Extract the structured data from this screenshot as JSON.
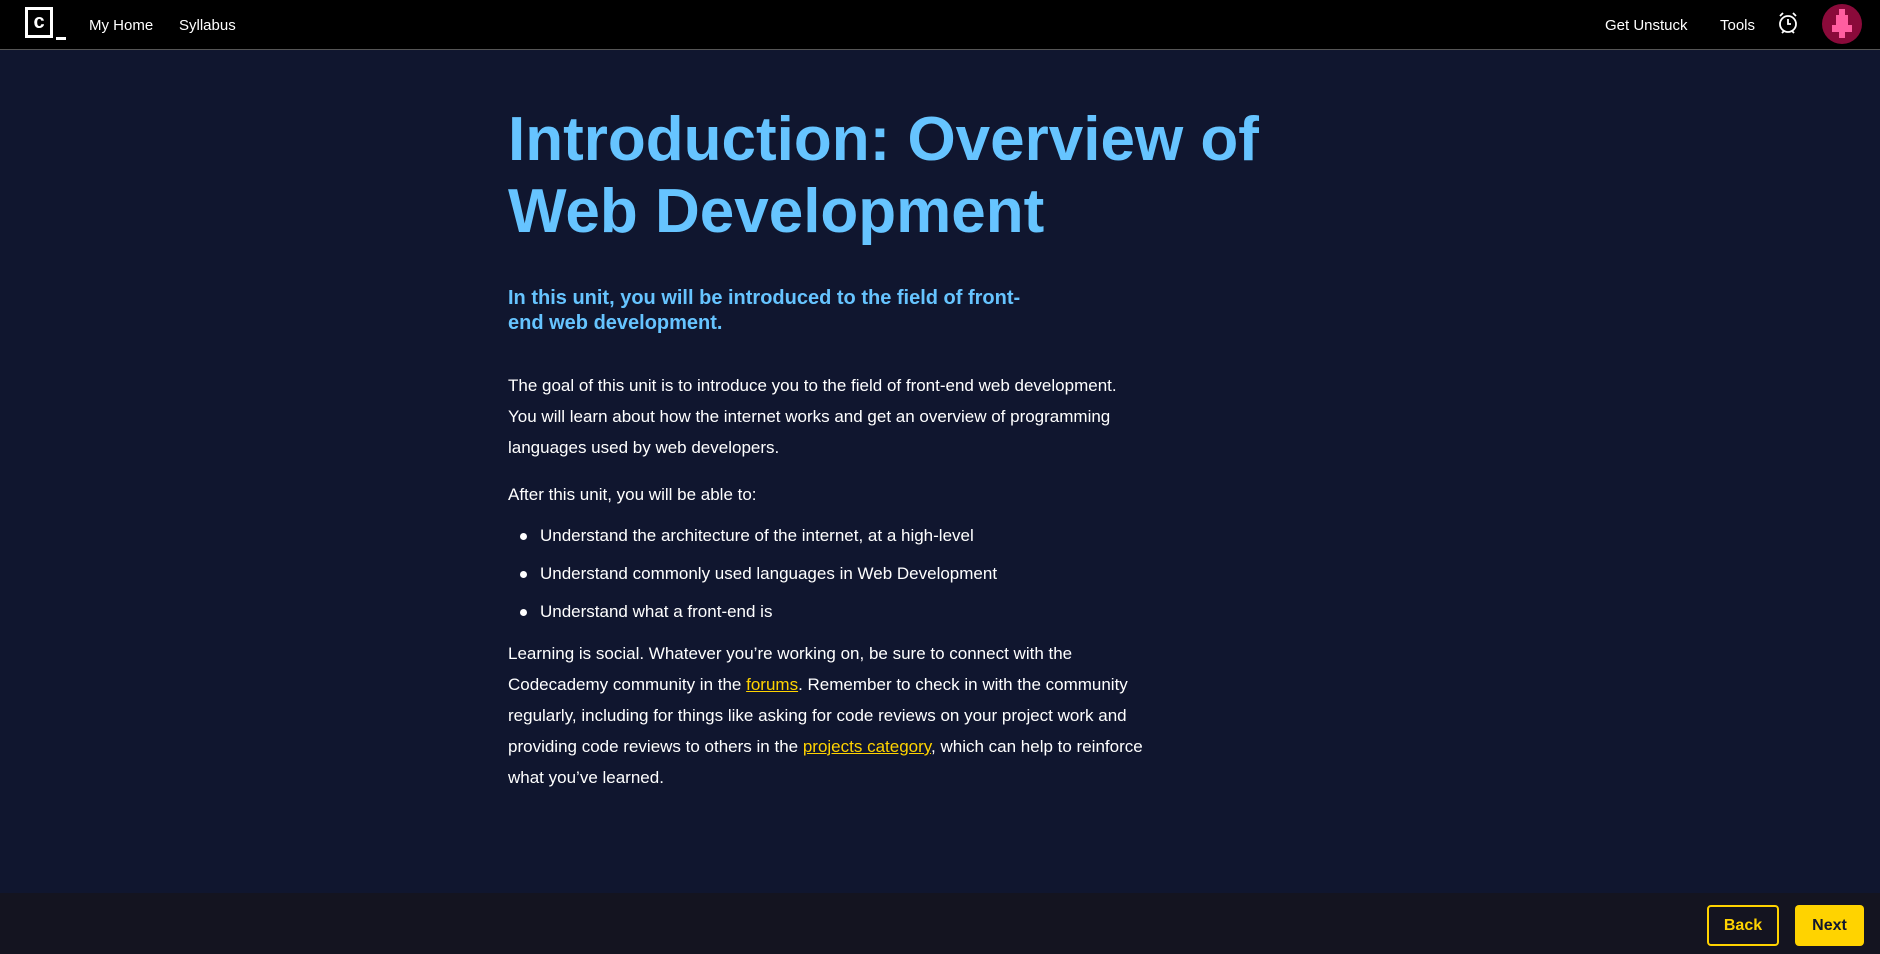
{
  "header": {
    "logo_letter": "c",
    "nav": [
      "My Home",
      "Syllabus"
    ],
    "right": [
      "Get Unstuck",
      "Tools"
    ],
    "icons": [
      "alarm-clock-icon",
      "avatar"
    ]
  },
  "main": {
    "title": "Introduction: Overview of Web Development",
    "subtitle": "In this unit, you will be introduced to the field of front-end web development.",
    "goal": "The goal of this unit is to introduce you to the field of front-end web development. You will learn about how the internet works and get an overview of programming languages used by web developers.",
    "after": "After this unit, you will be able to:",
    "bullets": [
      "Understand the architecture of the internet, at a high-level",
      "Understand commonly used languages in Web Development",
      "Understand what a front-end is"
    ],
    "social": {
      "t1": "Learning is social. Whatever you’re working on, be sure to connect with the Codecademy community in the ",
      "link1": "forums",
      "t2": ". Remember to check in with the community regularly, including for things like asking for code reviews on your project work and providing code reviews to others in the ",
      "link2": "projects category",
      "t3": ", which can help to reinforce what you’ve learned."
    }
  },
  "footer": {
    "back": "Back",
    "next": "Next"
  },
  "colors": {
    "accent": "#ffd300",
    "heading": "#66c4ff",
    "background": "#10162f"
  }
}
